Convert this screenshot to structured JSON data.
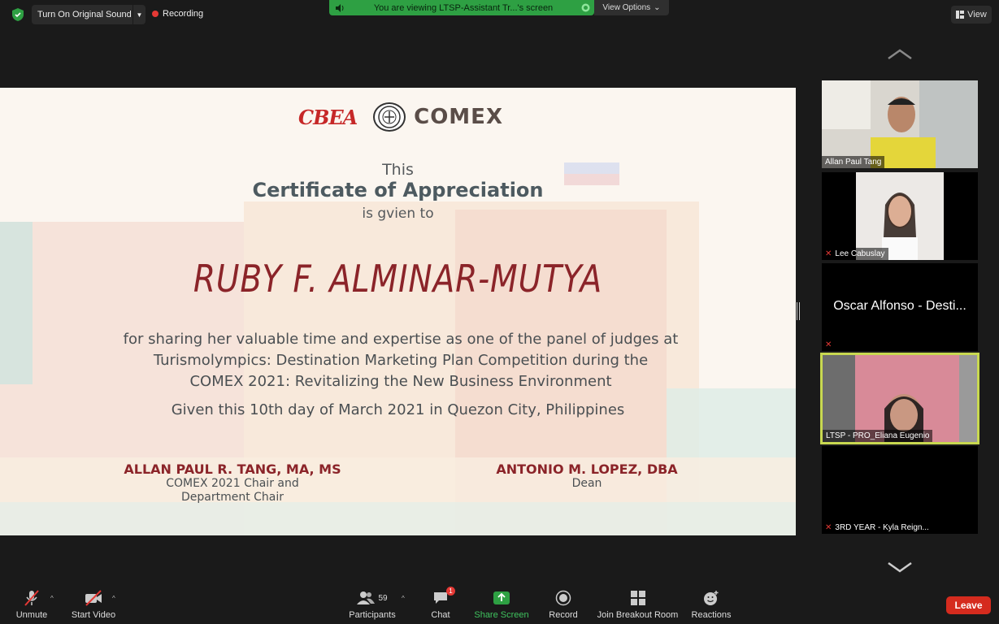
{
  "top": {
    "sound_button": "Turn On Original Sound",
    "recording": "Recording",
    "viewing_message": "You are viewing LTSP-Assistant Tr...'s screen",
    "view_options": "View Options",
    "view_button": "View"
  },
  "certificate": {
    "logo_left": "CBEA",
    "logo_right": "COMEX",
    "this": "This",
    "title": "Certificate of Appreciation",
    "given_to": "is gvien to",
    "recipient": "RUBY F. ALMINAR-MUTYA",
    "body_line1": "for sharing her valuable time and expertise as one of the panel of judges at",
    "body_line2": "Turismolympics: Destination Marketing Plan Competition during the",
    "body_line3": "COMEX 2021: Revitalizing the New Business Environment",
    "date_line": "Given this 10th day of March 2021 in Quezon City, Philippines",
    "sig1_name": "ALLAN PAUL R. TANG, MA, MS",
    "sig1_role1": "COMEX 2021 Chair and",
    "sig1_role2": "Department Chair",
    "sig2_name": "ANTONIO M. LOPEZ, DBA",
    "sig2_role": "Dean"
  },
  "participants_panel": [
    {
      "name": "Allan Paul Tang",
      "muted": false,
      "video": true
    },
    {
      "name": "Lee Cabuslay",
      "muted": true,
      "video": true
    },
    {
      "name": "Oscar Alfonso - Desti...",
      "muted": true,
      "video": false
    },
    {
      "name": "LTSP - PRO_Eliana Eugenio",
      "muted": false,
      "video": true,
      "active": true
    },
    {
      "name": "3RD YEAR - Kyla Reign...",
      "muted": true,
      "video": false
    }
  ],
  "toolbar": {
    "unmute": "Unmute",
    "start_video": "Start Video",
    "participants": "Participants",
    "participants_count": "59",
    "chat": "Chat",
    "chat_badge": "1",
    "share_screen": "Share Screen",
    "record": "Record",
    "breakout": "Join Breakout Room",
    "reactions": "Reactions",
    "leave": "Leave"
  },
  "colors": {
    "accent_green": "#2ea043",
    "leave_red": "#d52b1e",
    "cert_maroon": "#8b2429",
    "active_border": "#c8d850"
  }
}
